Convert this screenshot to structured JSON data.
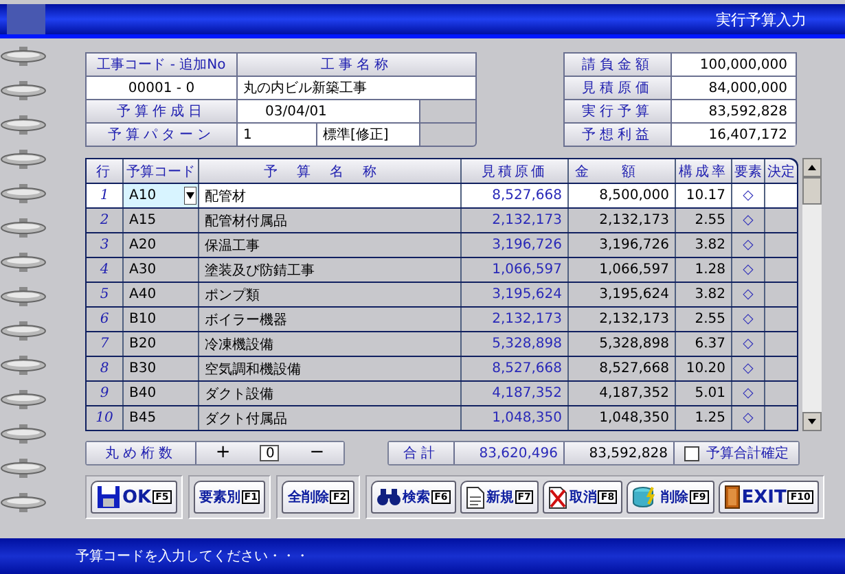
{
  "window": {
    "title": "実行予算入力"
  },
  "project": {
    "code_label": "工事コード - 追加No",
    "name_label": "工事名称",
    "code": "00001 - 0",
    "name": "丸の内ビル新築工事",
    "date_label": "予算作成日",
    "date": "03/04/01",
    "pattern_label": "予算パターン",
    "pattern_no": "1",
    "pattern_name": "標準[修正]"
  },
  "summary": [
    {
      "label": "請負金額",
      "value": "100,000,000"
    },
    {
      "label": "見積原価",
      "value": "84,000,000"
    },
    {
      "label": "実行予算",
      "value": "83,592,828"
    },
    {
      "label": "予想利益",
      "value": "16,407,172"
    }
  ],
  "grid": {
    "columns": [
      "行",
      "予算コード",
      "予算名称",
      "見積原価",
      "金額",
      "構成率",
      "要素",
      "決定"
    ],
    "rows": [
      {
        "no": "1",
        "code": "A10",
        "name": "配管材",
        "estimate": "8,527,668",
        "amount": "8,500,000",
        "ratio": "10.17",
        "element": "◇",
        "selected": true
      },
      {
        "no": "2",
        "code": "A15",
        "name": "配管材付属品",
        "estimate": "2,132,173",
        "amount": "2,132,173",
        "ratio": "2.55",
        "element": "◇",
        "selected": false
      },
      {
        "no": "3",
        "code": "A20",
        "name": "保温工事",
        "estimate": "3,196,726",
        "amount": "3,196,726",
        "ratio": "3.82",
        "element": "◇",
        "selected": false
      },
      {
        "no": "4",
        "code": "A30",
        "name": "塗装及び防錆工事",
        "estimate": "1,066,597",
        "amount": "1,066,597",
        "ratio": "1.28",
        "element": "◇",
        "selected": false
      },
      {
        "no": "5",
        "code": "A40",
        "name": "ポンプ類",
        "estimate": "3,195,624",
        "amount": "3,195,624",
        "ratio": "3.82",
        "element": "◇",
        "selected": false
      },
      {
        "no": "6",
        "code": "B10",
        "name": "ボイラー機器",
        "estimate": "2,132,173",
        "amount": "2,132,173",
        "ratio": "2.55",
        "element": "◇",
        "selected": false
      },
      {
        "no": "7",
        "code": "B20",
        "name": "冷凍機設備",
        "estimate": "5,328,898",
        "amount": "5,328,898",
        "ratio": "6.37",
        "element": "◇",
        "selected": false
      },
      {
        "no": "8",
        "code": "B30",
        "name": "空気調和機設備",
        "estimate": "8,527,668",
        "amount": "8,527,668",
        "ratio": "10.20",
        "element": "◇",
        "selected": false
      },
      {
        "no": "9",
        "code": "B40",
        "name": "ダクト設備",
        "estimate": "4,187,352",
        "amount": "4,187,352",
        "ratio": "5.01",
        "element": "◇",
        "selected": false
      },
      {
        "no": "10",
        "code": "B45",
        "name": "ダクト付属品",
        "estimate": "1,048,350",
        "amount": "1,048,350",
        "ratio": "1.25",
        "element": "◇",
        "selected": false
      }
    ]
  },
  "rounding": {
    "label": "丸め桁数",
    "plus": "+",
    "value": "0",
    "minus": "−"
  },
  "total": {
    "label": "合計",
    "estimate": "83,620,496",
    "amount": "83,592,828",
    "confirm_label": "予算合計確定",
    "confirmed": false
  },
  "button_groups": [
    [
      {
        "kind": "ok",
        "label": "OK",
        "key": "F5"
      }
    ],
    [
      {
        "kind": "plain",
        "label": "要素別",
        "key": "F1"
      }
    ],
    [
      {
        "kind": "plain",
        "label": "全削除",
        "key": "F2"
      }
    ],
    [
      {
        "kind": "search",
        "label": "検索",
        "key": "F6"
      },
      {
        "kind": "new",
        "label": "新規",
        "key": "F7"
      },
      {
        "kind": "cancel",
        "label": "取消",
        "key": "F8"
      },
      {
        "kind": "delete",
        "label": "削除",
        "key": "F9"
      },
      {
        "kind": "exit",
        "label": "EXIT",
        "key": "F10"
      }
    ]
  ],
  "status_bar": "予算コードを入力してください・・・"
}
